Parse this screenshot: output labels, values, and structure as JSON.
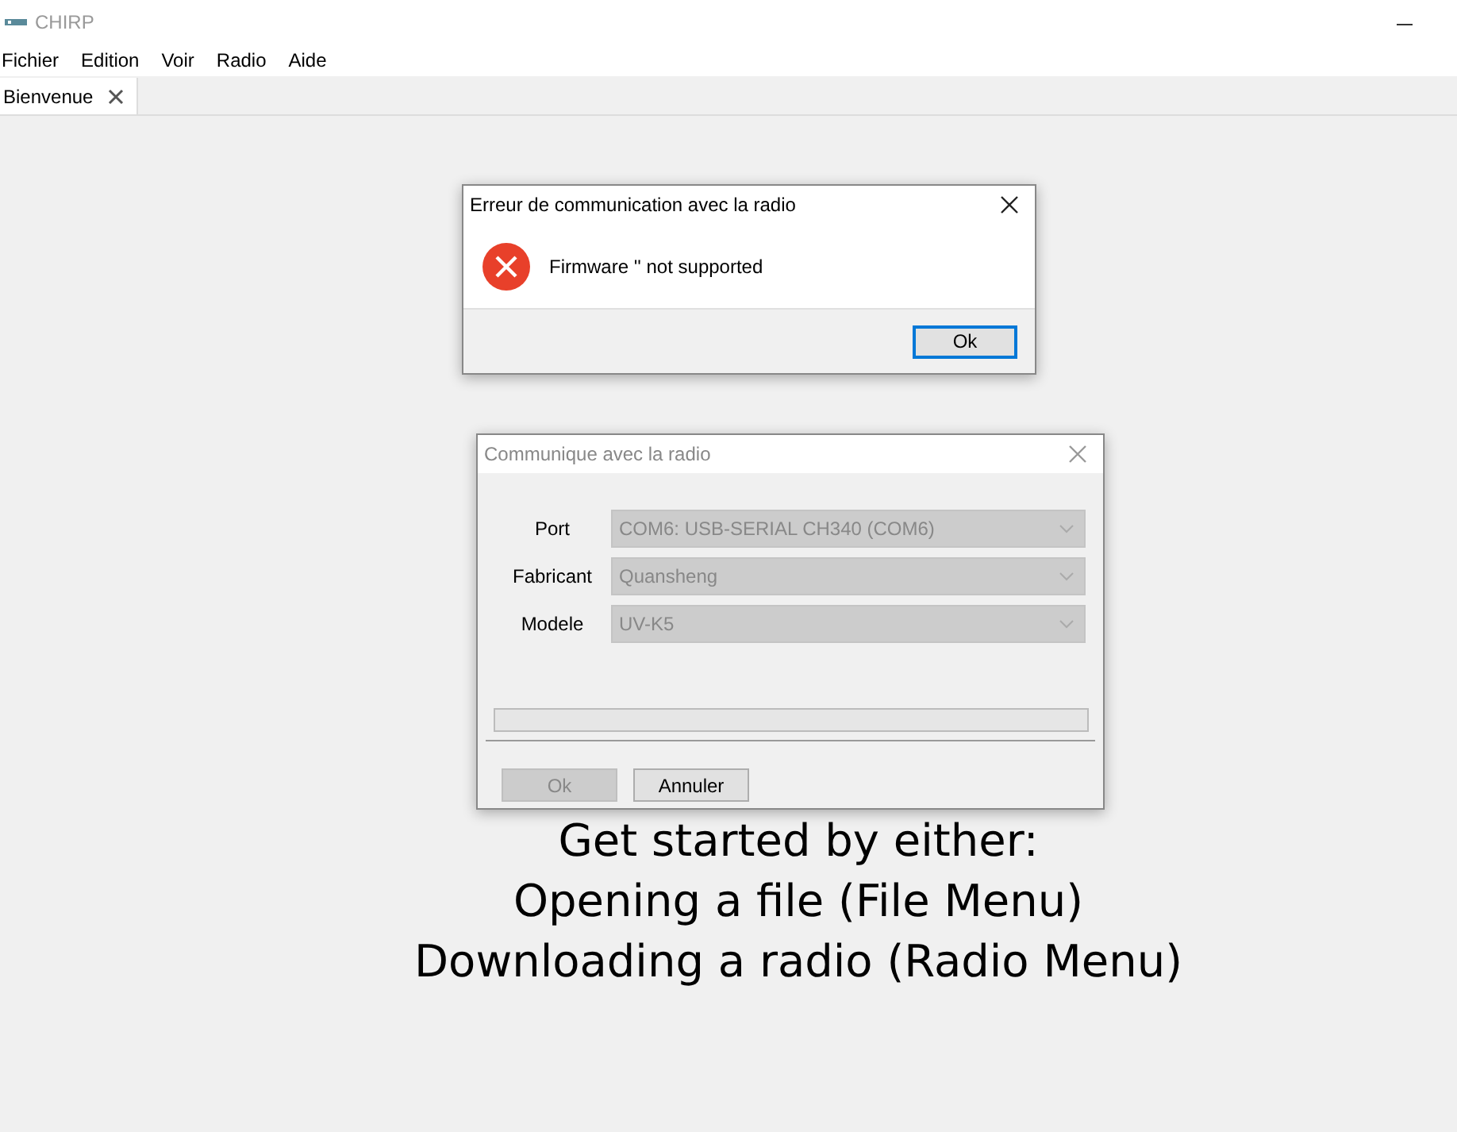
{
  "window": {
    "title": "CHIRP"
  },
  "menu": [
    "Fichier",
    "Edition",
    "Voir",
    "Radio",
    "Aide"
  ],
  "tabs": [
    {
      "label": "Bienvenue",
      "selected": true
    }
  ],
  "welcome": {
    "lines": [
      "Get started by either:",
      "Opening a file (File Menu)",
      "Downloading a radio (Radio Menu)"
    ]
  },
  "error_dialog": {
    "title": "Erreur de communication avec la radio",
    "message": "Firmware '' not supported",
    "buttons": [
      {
        "label": "Ok",
        "default": true,
        "disabled": false
      }
    ]
  },
  "radio_dialog": {
    "title": "Communique avec la radio",
    "active": false,
    "fields": [
      {
        "label": "Port",
        "value": "COM6: USB-SERIAL CH340 (COM6)",
        "disabled": true
      },
      {
        "label": "Fabricant",
        "value": "Quansheng",
        "disabled": true
      },
      {
        "label": "Modele",
        "value": "UV-K5",
        "disabled": true
      }
    ],
    "progress": {
      "level": 0
    },
    "buttons": [
      {
        "label": "Ok",
        "default": false,
        "disabled": true
      },
      {
        "label": "Annuler",
        "default": false,
        "disabled": false
      }
    ]
  }
}
